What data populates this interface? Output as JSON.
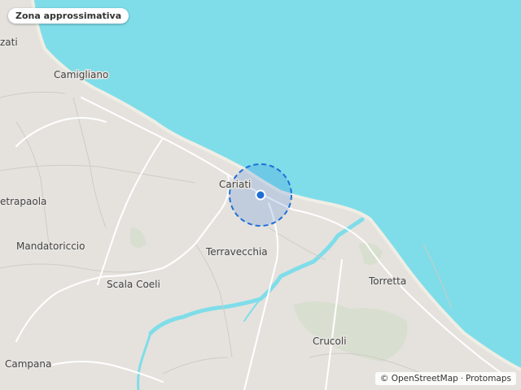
{
  "map": {
    "badge": "Zona approssimativa",
    "places": {
      "zati": "zati",
      "camigliano": "Camigliano",
      "cariati": "Cariati",
      "etrapaola": "etrapaola",
      "mandatoriccio": "Mandatoriccio",
      "terravecchia": "Terravecchia",
      "scala_coeli": "Scala Coeli",
      "torretta": "Torretta",
      "crucoli": "Crucoli",
      "campana": "Campana"
    },
    "colors": {
      "sea": "#7fdde9",
      "land": "#e5e2de",
      "river": "#7fdde9",
      "road": "#ffffff",
      "accuracy_circle": "#1f6fd6"
    },
    "attribution": {
      "symbol": "©",
      "osm": "OpenStreetMap",
      "separator": "·",
      "provider": "Protomaps"
    }
  }
}
